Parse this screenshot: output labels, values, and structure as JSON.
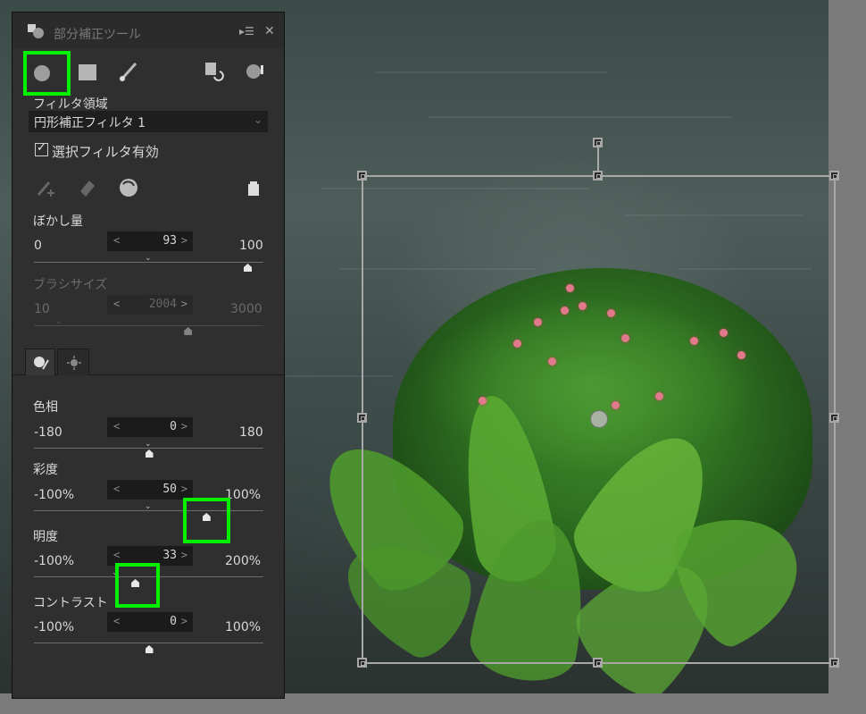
{
  "panel": {
    "title": "部分補正ツール",
    "filter_area_label": "フィルタ領域",
    "filter_select_value": "円形補正フィルタ 1",
    "enable_checkbox_label": "選択フィルタ有効",
    "blur": {
      "label": "ぼかし量",
      "min": "0",
      "max": "100",
      "value": "93",
      "fraction": 0.93
    },
    "brush_size": {
      "label": "ブラシサイズ",
      "min": "10",
      "max": "3000",
      "value": "2004",
      "fraction": 0.67
    },
    "hue": {
      "label": "色相",
      "min": "-180",
      "max": "180",
      "value": "0",
      "fraction": 0.5
    },
    "saturation": {
      "label": "彩度",
      "min": "-100%",
      "max": "100%",
      "value": "50",
      "fraction": 0.75
    },
    "brightness": {
      "label": "明度",
      "min": "-100%",
      "max": "200%",
      "value": "33",
      "fraction": 0.44
    },
    "contrast": {
      "label": "コントラスト",
      "min": "-100%",
      "max": "100%",
      "value": "0",
      "fraction": 0.5
    }
  },
  "icons": {
    "panel": "panel-icon",
    "menu": "panel-menu-icon",
    "close": "close-icon",
    "circle": "circle-filter-icon",
    "rect": "rectangle-filter-icon",
    "brush": "brush-filter-icon",
    "copy": "copy-filter-icon",
    "mask": "mask-icon",
    "add_brush": "add-brush-icon",
    "eraser": "eraser-icon",
    "invert": "invert-icon",
    "trash": "trash-icon",
    "tab_color": "color-adjust-tab-icon",
    "tab_light": "light-adjust-tab-icon"
  },
  "colors": {
    "highlight": "#00f200",
    "panel_bg": "#2f2f2f"
  }
}
